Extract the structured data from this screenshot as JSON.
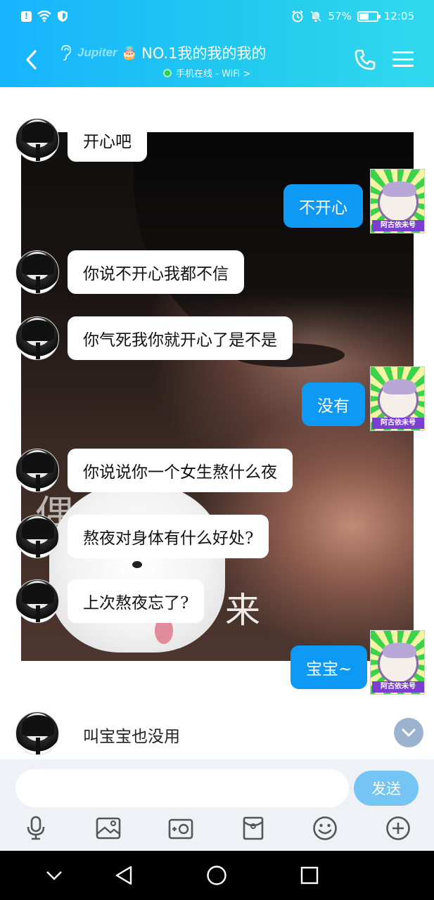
{
  "status_bar": {
    "battery": "57%",
    "time": "12:05"
  },
  "header": {
    "brand": "Jupiter",
    "title": "NO.1我的我的我的",
    "subtitle": "手机在线 - WiFi >"
  },
  "background": {
    "left_char": "偶",
    "right_char": "来"
  },
  "messages": [
    {
      "side": "in",
      "text": "开心吧"
    },
    {
      "side": "out",
      "text": "不开心"
    },
    {
      "side": "in",
      "text": "你说不开心我都不信"
    },
    {
      "side": "in",
      "text": "你气死我你就开心了是不是"
    },
    {
      "side": "out",
      "text": "没有"
    },
    {
      "side": "in",
      "text": "你说说你一个女生熬什么夜"
    },
    {
      "side": "in",
      "text": "熬夜对身体有什么好处?"
    },
    {
      "side": "in",
      "text": "上次熬夜忘了?"
    },
    {
      "side": "out",
      "text": "宝宝~"
    },
    {
      "side": "in",
      "text": "叫宝宝也没用"
    }
  ],
  "my_avatar_tag": "阿古依未号",
  "input": {
    "placeholder": "",
    "send_label": "发送"
  },
  "toolbar": [
    "voice-icon",
    "photo-icon",
    "camera-icon",
    "red-packet-icon",
    "emoji-icon",
    "plus-icon"
  ],
  "colors": {
    "header_start": "#17b4ff",
    "header_end": "#31d9ef",
    "outgoing_bubble": "#0e99f5",
    "send_button": "#74c4f4"
  }
}
